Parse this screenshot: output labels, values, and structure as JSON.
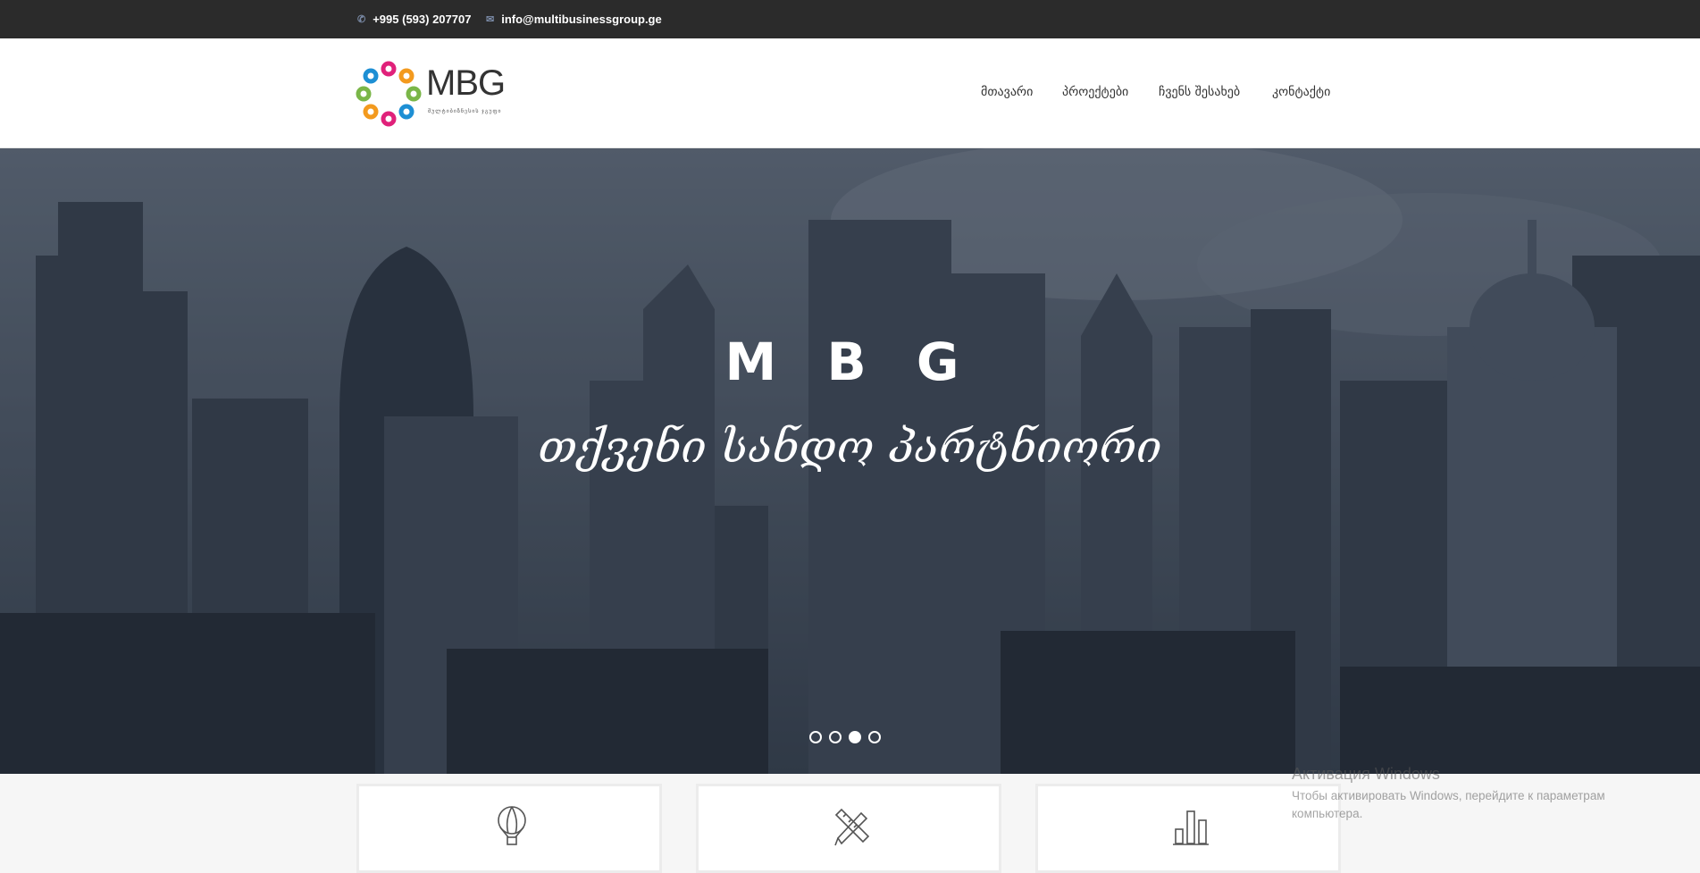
{
  "topbar": {
    "phone": "+995 (593) 207707",
    "email": "info@multibusinessgroup.ge",
    "phone_icon": "phone-icon",
    "email_icon": "envelope-icon"
  },
  "logo": {
    "text": "MBG",
    "subtitle": "მულტიბიზნესის ჯგუფი"
  },
  "nav": {
    "items": [
      {
        "label": "მთავარი"
      },
      {
        "label": "პროექტები"
      },
      {
        "label": "ჩვენს შესახებ"
      },
      {
        "label": "კონტაქტი"
      }
    ]
  },
  "hero": {
    "title": "M B G",
    "subtitle": "თქვენი სანდო პარტნიორი",
    "slides": 4,
    "active_slide": 3
  },
  "cards": [
    {
      "icon": "hot-air-balloon-icon"
    },
    {
      "icon": "pencil-ruler-icon"
    },
    {
      "icon": "bar-chart-icon"
    }
  ],
  "watermark": {
    "title": "Активация Windows",
    "line1": "Чтобы активировать Windows, перейдите к параметрам",
    "line2": "компьютера."
  },
  "colors": {
    "topbar_bg": "#2b2b2b",
    "header_bg": "#ffffff",
    "hero_overlay": "#3d4756"
  }
}
